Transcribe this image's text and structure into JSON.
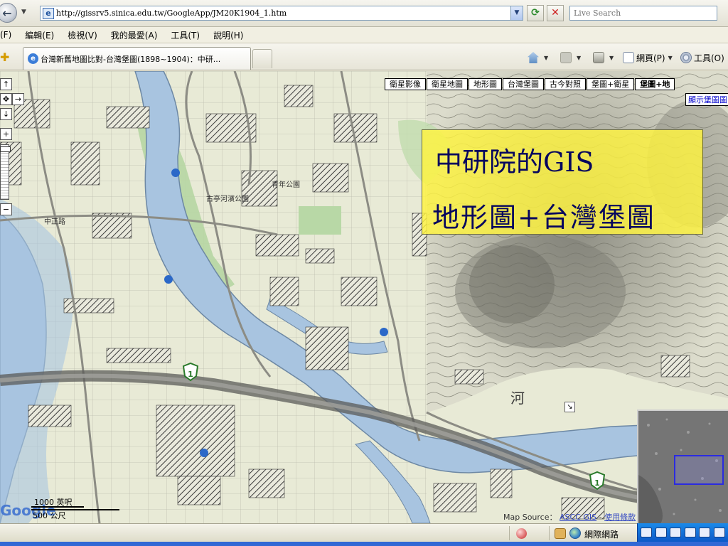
{
  "browser": {
    "url": "http://gissrv5.sinica.edu.tw/GoogleApp/JM20K1904_1.htm",
    "search_placeholder": "Live Search",
    "menu": [
      "(F)",
      "編輯(E)",
      "檢視(V)",
      "我的最愛(A)",
      "工具(T)",
      "說明(H)"
    ],
    "tab_title": "台灣新舊地圖比對-台灣堡圖(1898~1904)：中研...",
    "commands": {
      "page": "網頁(P)",
      "tools": "工具(O)"
    },
    "status": {
      "zone": "網際網路"
    }
  },
  "map": {
    "map_types": [
      "衛星影像",
      "衛星地圖",
      "地形圖",
      "台灣堡圖",
      "古今對照",
      "堡圖+衛星",
      "堡圖+地"
    ],
    "selected_type": "堡圖+地",
    "show_overlay_label": "顯示堡圖圖",
    "title_box": {
      "line1": "中研院的GIS",
      "line2": "地形圖+台灣堡圖"
    },
    "scale": {
      "top": "1000 英呎",
      "bottom": "500 公尺"
    },
    "logo": "Google",
    "attribution": {
      "prefix": "Map Source：",
      "source_link": "ASCC GIS",
      "separator": "-",
      "terms_link": "使用條款"
    },
    "labels": {
      "river": "河",
      "park1": "古亭河濱公園",
      "park2": "青年公園",
      "route": "1",
      "road": "中正路"
    },
    "controls": {
      "pan_up": "↑",
      "pan_left": "←",
      "pan_right": "→",
      "pan_center": "✥",
      "pan_down": "↓",
      "zoom_in": "+",
      "zoom_out": "−",
      "overview_toggle": "↘"
    }
  }
}
